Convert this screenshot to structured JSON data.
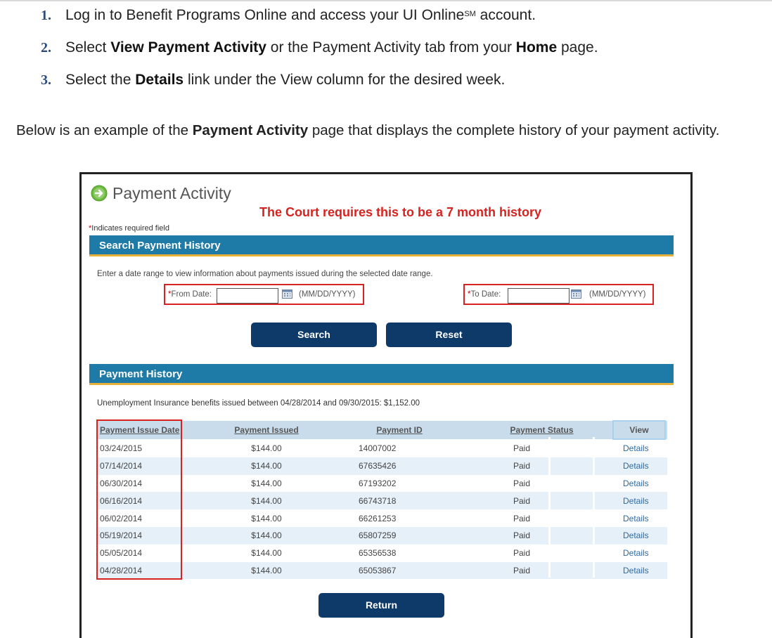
{
  "instructions": {
    "steps": [
      {
        "num": "1.",
        "pre": "Log in to Benefit Programs Online and access your UI Online",
        "sup": "SM",
        "post": " account."
      },
      {
        "num": "2.",
        "pre": "Select ",
        "bold1": "View Payment Activity",
        "mid": " or the Payment Activity tab from your ",
        "bold2": "Home",
        "post": " page."
      },
      {
        "num": "3.",
        "pre": "Select the ",
        "bold1": "Details",
        "post": " link under the View column for the desired week."
      }
    ],
    "intro_pre": "Below is an example of the ",
    "intro_bold": "Payment Activity",
    "intro_post": " page that displays the complete history of your payment activity."
  },
  "page": {
    "title": "Payment Activity",
    "court_note": "The Court requires this to be a 7 month history",
    "required_note": "Indicates required field",
    "required_star": "*"
  },
  "search": {
    "header": "Search Payment History",
    "description": "Enter a date range to view information about payments issued during the selected date range.",
    "from_label": "From Date:",
    "to_label": "To Date:",
    "format_hint": "(MM/DD/YYYY)",
    "from_value": "",
    "to_value": "",
    "search_button": "Search",
    "reset_button": "Reset"
  },
  "history": {
    "header": "Payment History",
    "summary": "Unemployment Insurance benefits issued between 04/28/2014 and 09/30/2015: $1,152.00",
    "columns": [
      "Payment Issue Date",
      "Payment Issued",
      "Payment ID",
      "Payment Status",
      "View"
    ],
    "rows": [
      {
        "date": "03/24/2015",
        "amount": "$144.00",
        "id": "14007002",
        "status": "Paid",
        "view": "Details"
      },
      {
        "date": "07/14/2014",
        "amount": "$144.00",
        "id": "67635426",
        "status": "Paid",
        "view": "Details"
      },
      {
        "date": "06/30/2014",
        "amount": "$144.00",
        "id": "67193202",
        "status": "Paid",
        "view": "Details"
      },
      {
        "date": "06/16/2014",
        "amount": "$144.00",
        "id": "66743718",
        "status": "Paid",
        "view": "Details"
      },
      {
        "date": "06/02/2014",
        "amount": "$144.00",
        "id": "66261253",
        "status": "Paid",
        "view": "Details"
      },
      {
        "date": "05/19/2014",
        "amount": "$144.00",
        "id": "65807259",
        "status": "Paid",
        "view": "Details"
      },
      {
        "date": "05/05/2014",
        "amount": "$144.00",
        "id": "65356538",
        "status": "Paid",
        "view": "Details"
      },
      {
        "date": "04/28/2014",
        "amount": "$144.00",
        "id": "65053867",
        "status": "Paid",
        "view": "Details"
      }
    ],
    "return_button": "Return"
  },
  "colors": {
    "header_bar": "#1e7aa6",
    "header_underline": "#e8b23a",
    "button": "#0e3a6a",
    "highlight": "#d7221f",
    "link": "#2a6aa8"
  },
  "icons": {
    "title_icon": "green-arrow-circle-icon",
    "date_picker": "calendar-icon"
  }
}
